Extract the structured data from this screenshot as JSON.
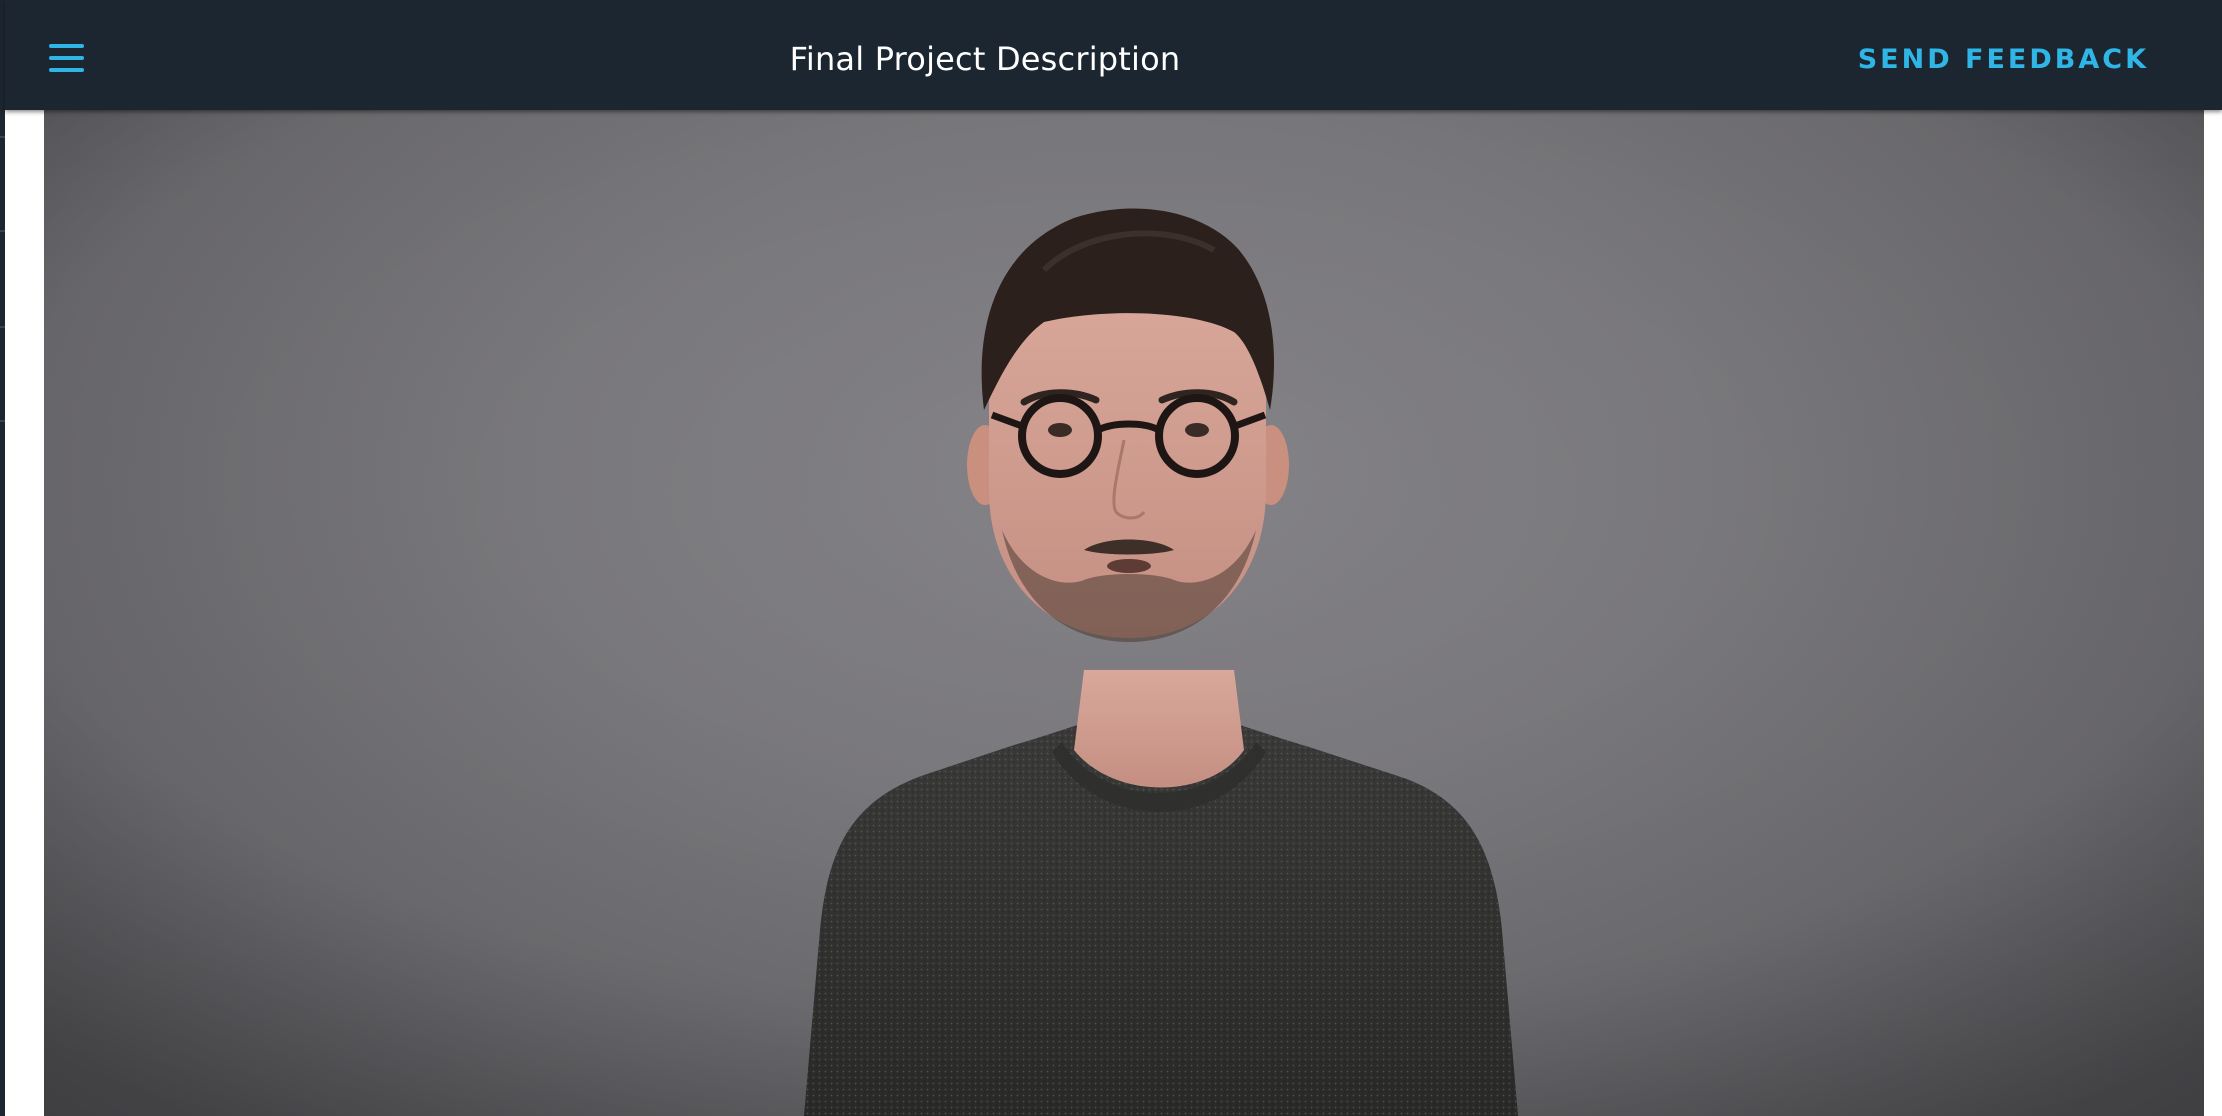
{
  "header": {
    "menu_icon": "hamburger-menu-icon",
    "title": "Final Project Description",
    "feedback_label": "SEND FEEDBACK"
  },
  "video": {
    "content": "presenter-video-frame"
  },
  "colors": {
    "topbar_background": "#1c2631",
    "accent": "#2fb6e6",
    "title_text": "#ffffff",
    "video_backdrop": "#7c7b7f"
  }
}
